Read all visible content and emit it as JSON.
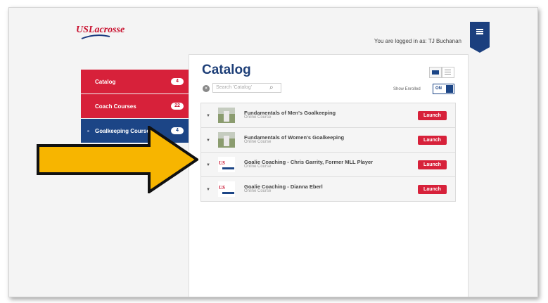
{
  "header": {
    "logo_text": "USLacrosse",
    "login_text": "You are logged in as: TJ Buchanan"
  },
  "sidebar": {
    "items": [
      {
        "label": "Catalog",
        "count": "4"
      },
      {
        "label": "Coach Courses",
        "count": "22"
      },
      {
        "label": "Goalkeeping Courses",
        "count": "4"
      }
    ]
  },
  "catalog": {
    "title": "Catalog",
    "search_placeholder": "Search 'Catalog'",
    "show_enrolled_label": "Show Enrolled",
    "toggle_value": "ON",
    "courses": [
      {
        "title": "Fundamentals of Men's Goalkeeping",
        "subtitle": "Online Course",
        "action": "Launch"
      },
      {
        "title": "Fundamentals of Women's Goalkeeping",
        "subtitle": "Online Course",
        "action": "Launch"
      },
      {
        "title": "Goalie Coaching - Chris Garrity, Former MLL Player",
        "subtitle": "Online Course",
        "action": "Launch"
      },
      {
        "title": "Goalie Coaching - Dianna Eberl",
        "subtitle": "Online Course",
        "action": "Launch"
      }
    ]
  },
  "colors": {
    "brand_red": "#d7213a",
    "brand_blue": "#1c4586",
    "annotation_arrow": "#f7b500"
  },
  "icons": {
    "menu": "menu-icon",
    "clear": "clear-search-icon",
    "search": "search-icon",
    "folder_view": "folder-view-icon",
    "list_view": "list-view-icon",
    "expand": "chevron-down-icon"
  }
}
